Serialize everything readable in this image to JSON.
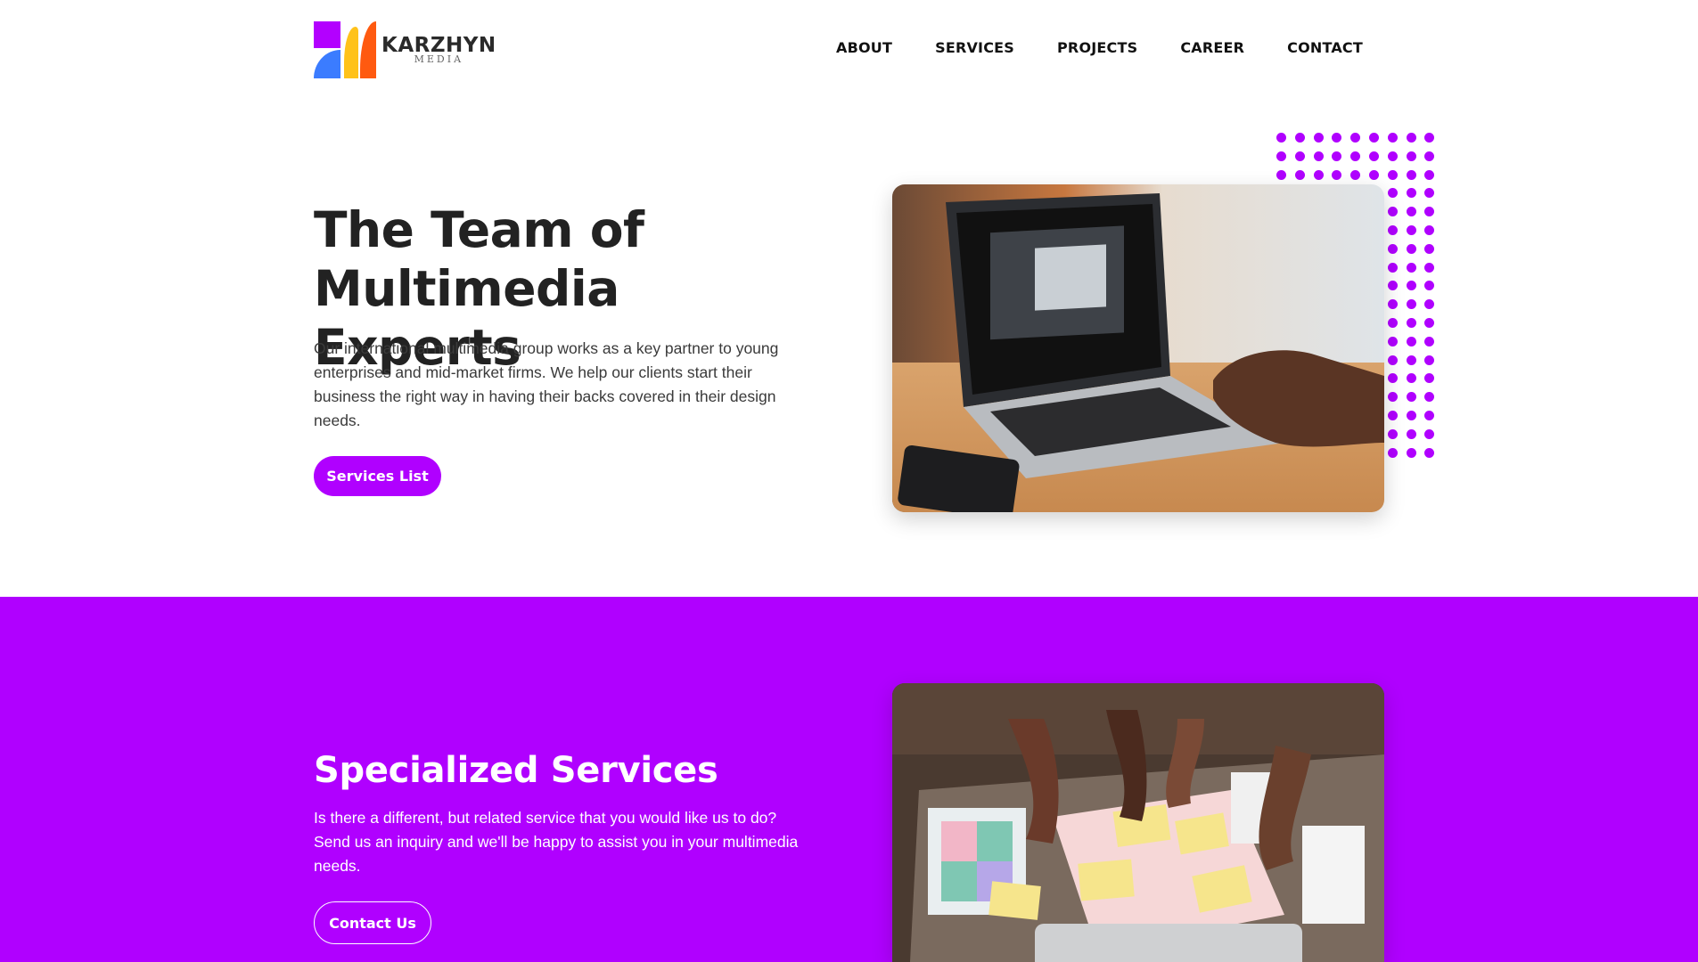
{
  "brand": {
    "name": "KARZHYN",
    "sub": "MEDIA",
    "accent": "#b000ff"
  },
  "nav": {
    "items": [
      {
        "label": "ABOUT"
      },
      {
        "label": "SERVICES"
      },
      {
        "label": "PROJECTS"
      },
      {
        "label": "CAREER"
      },
      {
        "label": "CONTACT"
      }
    ]
  },
  "hero": {
    "title": "The Team of Multimedia Experts",
    "text": "Our international multimedia group works as a key partner to young enterprises and mid-market firms. We help our clients start their business the right way in having their backs covered in their design needs.",
    "button": "Services List",
    "image_icon": "laptop-photo"
  },
  "services": {
    "title": "Specialized Services",
    "text": "Is there a different, but related service that you would like us to do? Send us an inquiry and we'll be happy to assist you in your multimedia needs.",
    "button": "Contact Us",
    "background": "#b000ff",
    "image_icon": "wireframe-sketch-photo"
  }
}
